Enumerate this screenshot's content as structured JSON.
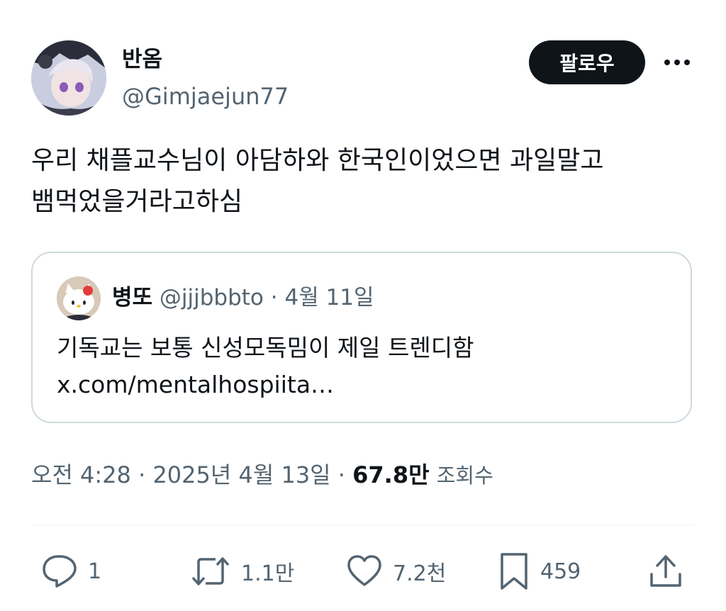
{
  "author": {
    "name": "반옴",
    "handle": "@Gimjaejun77",
    "avatar_icon": "anime-avatar"
  },
  "follow_label": "팔로우",
  "tweet": {
    "line1": "우리 채플교수님이 아담하와 한국인이었으면 과일말고",
    "line2": "뱀먹었을거라고하심"
  },
  "quote": {
    "name": "병또",
    "handle": "@jjjbbbto",
    "separator": "·",
    "date": "4월 11일",
    "text_line1": "기독교는 보통 신성모독밈이 제일 트렌디함",
    "text_line2": "x.com/mentalhospiita…",
    "avatar_icon": "hello-kitty-avatar"
  },
  "meta": {
    "time": "오전 4:28",
    "separator": "·",
    "date": "2025년 4월 13일",
    "views_count": "67.8만",
    "views_label": "조회수"
  },
  "actions": {
    "reply_count": "1",
    "retweet_count": "1.1만",
    "like_count": "7.2천",
    "bookmark_count": "459"
  },
  "colors": {
    "text_primary": "#0f1419",
    "text_secondary": "#536471",
    "border": "#cfd9de",
    "button_bg": "#0f1419"
  }
}
